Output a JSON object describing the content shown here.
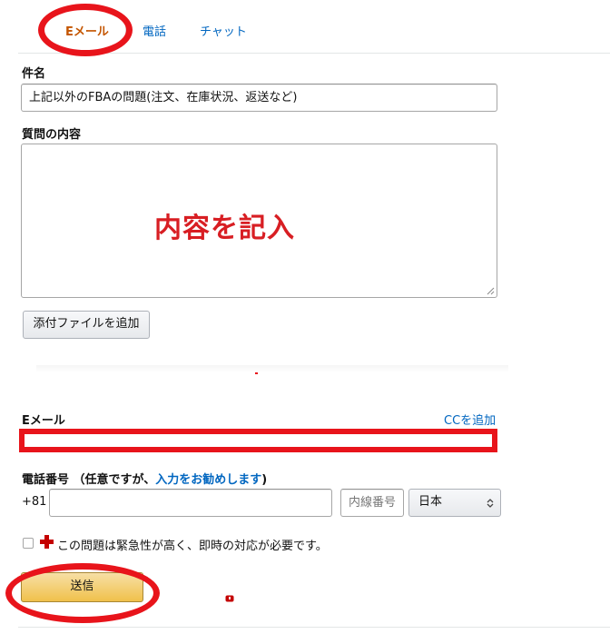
{
  "tabs": [
    {
      "label": "Eメール",
      "selected": true
    },
    {
      "label": "電話",
      "selected": false
    },
    {
      "label": "チャット",
      "selected": false
    }
  ],
  "subject": {
    "label": "件名",
    "value": "上記以外のFBAの問題(注文、在庫状況、返送など)"
  },
  "question": {
    "label": "質問の内容",
    "value": ""
  },
  "overlay_text": "内容を記入",
  "attach_button": "添付ファイルを追加",
  "email": {
    "label": "Eメール",
    "cc_link": "CCを追加",
    "value": ""
  },
  "phone": {
    "label": "電話番号 （任意ですが、",
    "label_link": "入力をお勧めします",
    "label_suffix": ")",
    "country_code": "+81",
    "value": "",
    "extension_placeholder": "内線番号",
    "country_select": "日本"
  },
  "urgent": {
    "checked": false,
    "label": "この問題は緊急性が高く、即時の対応が必要です。"
  },
  "submit_button": "送信",
  "colors": {
    "accent_orange": "#c45500",
    "link_blue": "#0066c0",
    "annotation_red": "#e8141b",
    "primary_button": "#f0c14b"
  }
}
